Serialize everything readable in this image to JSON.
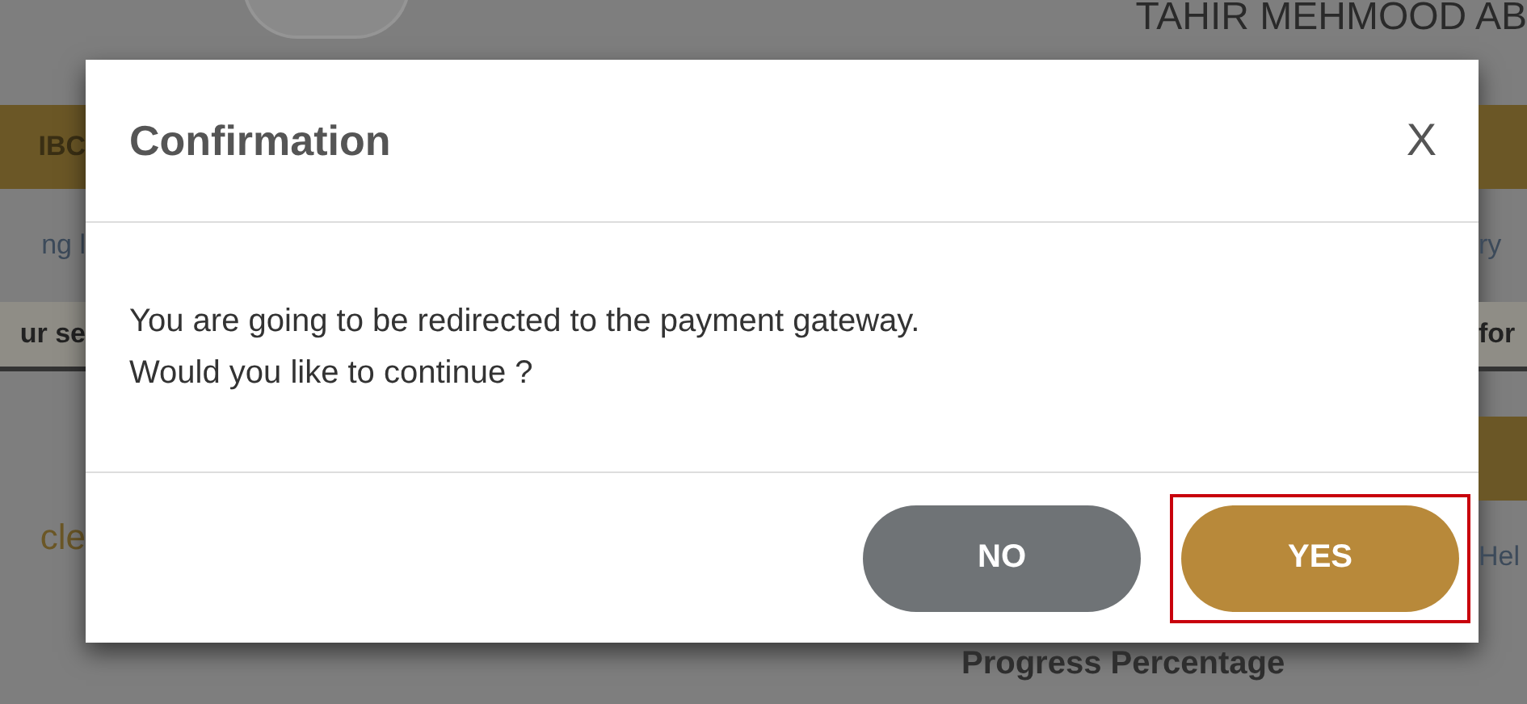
{
  "background": {
    "header_name": "TAHIR MEHMOOD AB",
    "left_fragments": [
      {
        "kind": "band",
        "text": "IBC"
      },
      {
        "kind": "plain",
        "text": "ng l"
      },
      {
        "kind": "tab",
        "text": "ur se"
      },
      {
        "kind": "link",
        "text": "cle"
      }
    ],
    "right_fragments": [
      {
        "kind": "band"
      },
      {
        "kind": "plain",
        "text": "ry"
      },
      {
        "kind": "tab",
        "text": "for"
      },
      {
        "kind": "band"
      },
      {
        "kind": "plain",
        "text": "Hel"
      }
    ],
    "footer_label": "Progress Percentage"
  },
  "dialog": {
    "title": "Confirmation",
    "close": "X",
    "message_lines": [
      "You are going to be redirected to the payment gateway.",
      "Would you like to continue ?"
    ],
    "buttons": [
      {
        "label": "NO",
        "kind": "secondary",
        "highlighted": false
      },
      {
        "label": "YES",
        "kind": "primary",
        "highlighted": true
      }
    ]
  }
}
